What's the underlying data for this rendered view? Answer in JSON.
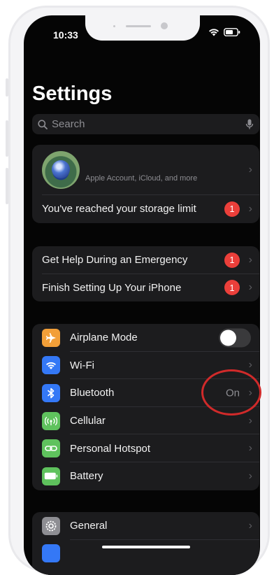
{
  "status_bar": {
    "time": "10:33"
  },
  "header": {
    "title": "Settings"
  },
  "search": {
    "placeholder": "Search"
  },
  "account": {
    "subtitle": "Apple Account, iCloud, and more",
    "storage_label": "You've reached your storage limit",
    "storage_badge": "1"
  },
  "alerts": {
    "items": [
      {
        "label": "Get Help During an Emergency",
        "badge": "1"
      },
      {
        "label": "Finish Setting Up Your iPhone",
        "badge": "1"
      }
    ]
  },
  "connectivity": {
    "items": [
      {
        "label": "Airplane Mode",
        "icon": "airplane-icon",
        "icon_color": "#f29f38",
        "toggle_on": false
      },
      {
        "label": "Wi-Fi",
        "icon": "wifi-icon",
        "icon_color": "#3478f6"
      },
      {
        "label": "Bluetooth",
        "icon": "bluetooth-icon",
        "icon_color": "#3478f6",
        "value": "On"
      },
      {
        "label": "Cellular",
        "icon": "cellular-icon",
        "icon_color": "#5fc25d"
      },
      {
        "label": "Personal Hotspot",
        "icon": "hotspot-icon",
        "icon_color": "#5fc25d"
      },
      {
        "label": "Battery",
        "icon": "battery-icon",
        "icon_color": "#5fc25d"
      }
    ]
  },
  "general": {
    "items": [
      {
        "label": "General",
        "icon": "gear-icon",
        "icon_color": "#8e8e93"
      }
    ]
  },
  "colors": {
    "background": "#050505",
    "cell": "#1c1c1e",
    "badge": "#eb3f3a",
    "highlight": "#d02a2a"
  }
}
